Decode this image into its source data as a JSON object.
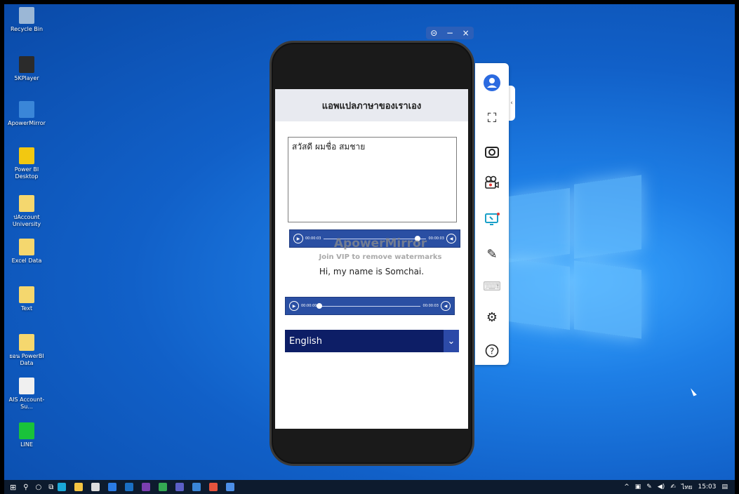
{
  "desktop": {
    "icons": [
      {
        "label": "Recycle Bin",
        "color": "#9bb7d6"
      },
      {
        "label": "5KPlayer",
        "color": "#2b2b2b"
      },
      {
        "label": "ApowerMirror",
        "color": "#3a86d8"
      },
      {
        "label": "Power BI Desktop",
        "color": "#f2c811"
      },
      {
        "label": "ปAccount University",
        "color": "#f5d76e"
      },
      {
        "label": "Excel Data",
        "color": "#f5d76e"
      },
      {
        "label": "Text",
        "color": "#f5d76e"
      },
      {
        "label": "ยอน PowerBI Data",
        "color": "#f5d76e"
      },
      {
        "label": "AIS Account-Su...",
        "color": "#f0f0f0"
      },
      {
        "label": "LINE",
        "color": "#19c33a"
      }
    ]
  },
  "mirror_window": {
    "controls": [
      "⊝",
      "−",
      "×"
    ]
  },
  "app": {
    "title": "แอพแปลภาษาของเราเอง",
    "input_text": "สวัสดี ผมชื่อ สมชาย",
    "audio1": {
      "time_start": "00:00:03",
      "time_end": "00:00:03",
      "progress": 0.92
    },
    "watermark_title": "ApowerMirror",
    "watermark_sub": "Join VIP to remove watermarks",
    "translated_text": "Hi, my name is Somchai.",
    "audio2": {
      "time_start": "00:00:00",
      "time_end": "00:00:03",
      "progress": 0.0
    },
    "language": {
      "selected": "English"
    }
  },
  "toolbar": {
    "items": [
      "user-icon",
      "fullscreen-icon",
      "screenshot-icon",
      "record-icon",
      "mirror-screen-icon",
      "whiteboard-icon",
      "keyboard-icon",
      "settings-icon",
      "help-icon"
    ]
  },
  "taskbar": {
    "lang": "ไทย",
    "time": "15:03"
  }
}
